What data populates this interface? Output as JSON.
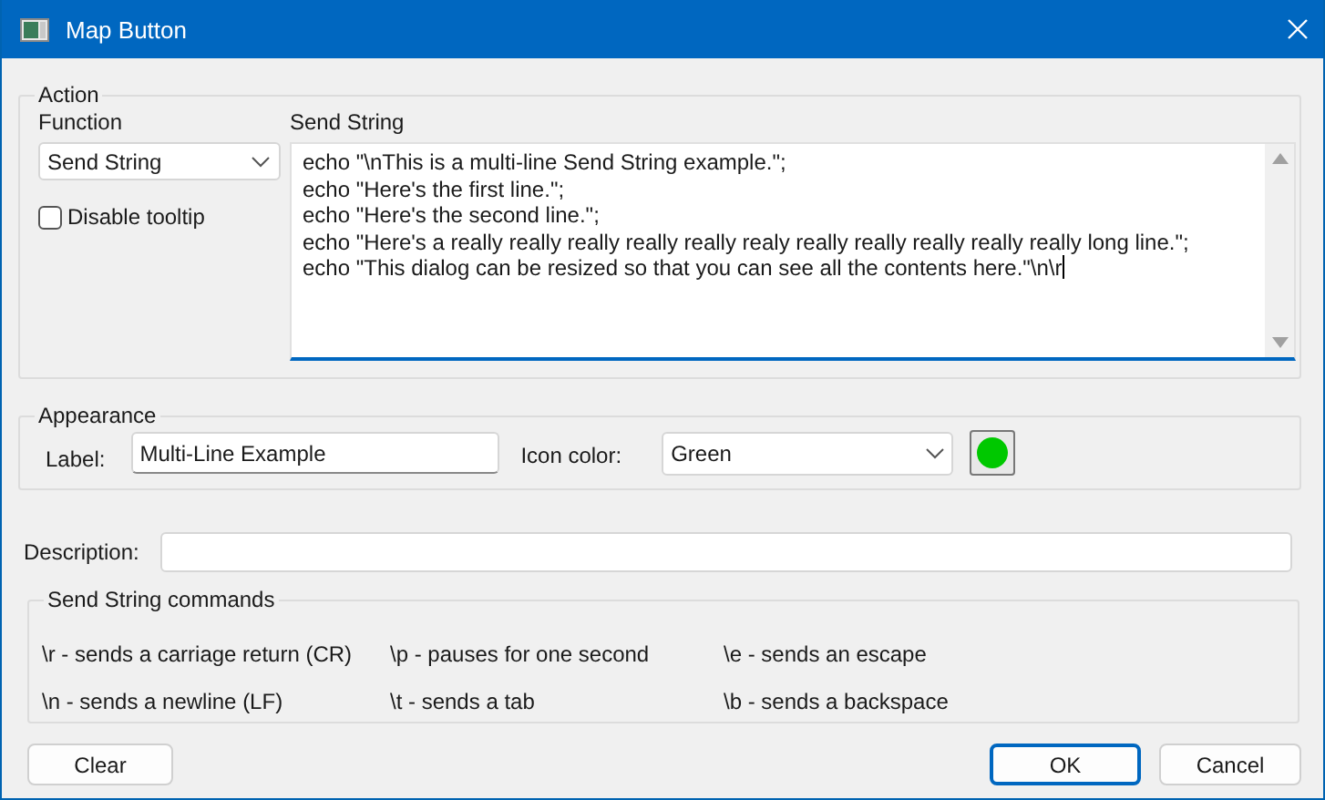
{
  "window": {
    "title": "Map Button"
  },
  "action": {
    "legend": "Action",
    "function": {
      "label": "Function",
      "value": "Send String"
    },
    "disable_tooltip": {
      "label": "Disable tooltip",
      "checked": false
    },
    "send_string": {
      "label": "Send String",
      "lines": [
        "echo \"\\nThis is a multi-line Send String example.\";",
        "echo \"Here's the first line.\";",
        "echo \"Here's the second line.\";",
        "echo \"Here's a really really really really really realy really really really really really long line.\";",
        "echo \"This dialog can be resized so that you can see all the contents here.\"\\n\\r"
      ]
    }
  },
  "appearance": {
    "legend": "Appearance",
    "label": {
      "label": "Label:",
      "value": "Multi-Line Example"
    },
    "icon_color": {
      "label": "Icon color:",
      "value": "Green",
      "color": "#00c800"
    }
  },
  "description": {
    "label": "Description:"
  },
  "commands": {
    "legend": "Send String commands",
    "items": [
      "\\r - sends a carriage return (CR)",
      "\\p - pauses for one second",
      "\\e - sends an escape",
      "\\n - sends a newline (LF)",
      "\\t - sends a tab",
      "\\b - sends a backspace"
    ]
  },
  "buttons": [
    {
      "label": "Clear",
      "default": false
    },
    {
      "label": "OK",
      "default": true
    },
    {
      "label": "Cancel",
      "default": false
    }
  ]
}
